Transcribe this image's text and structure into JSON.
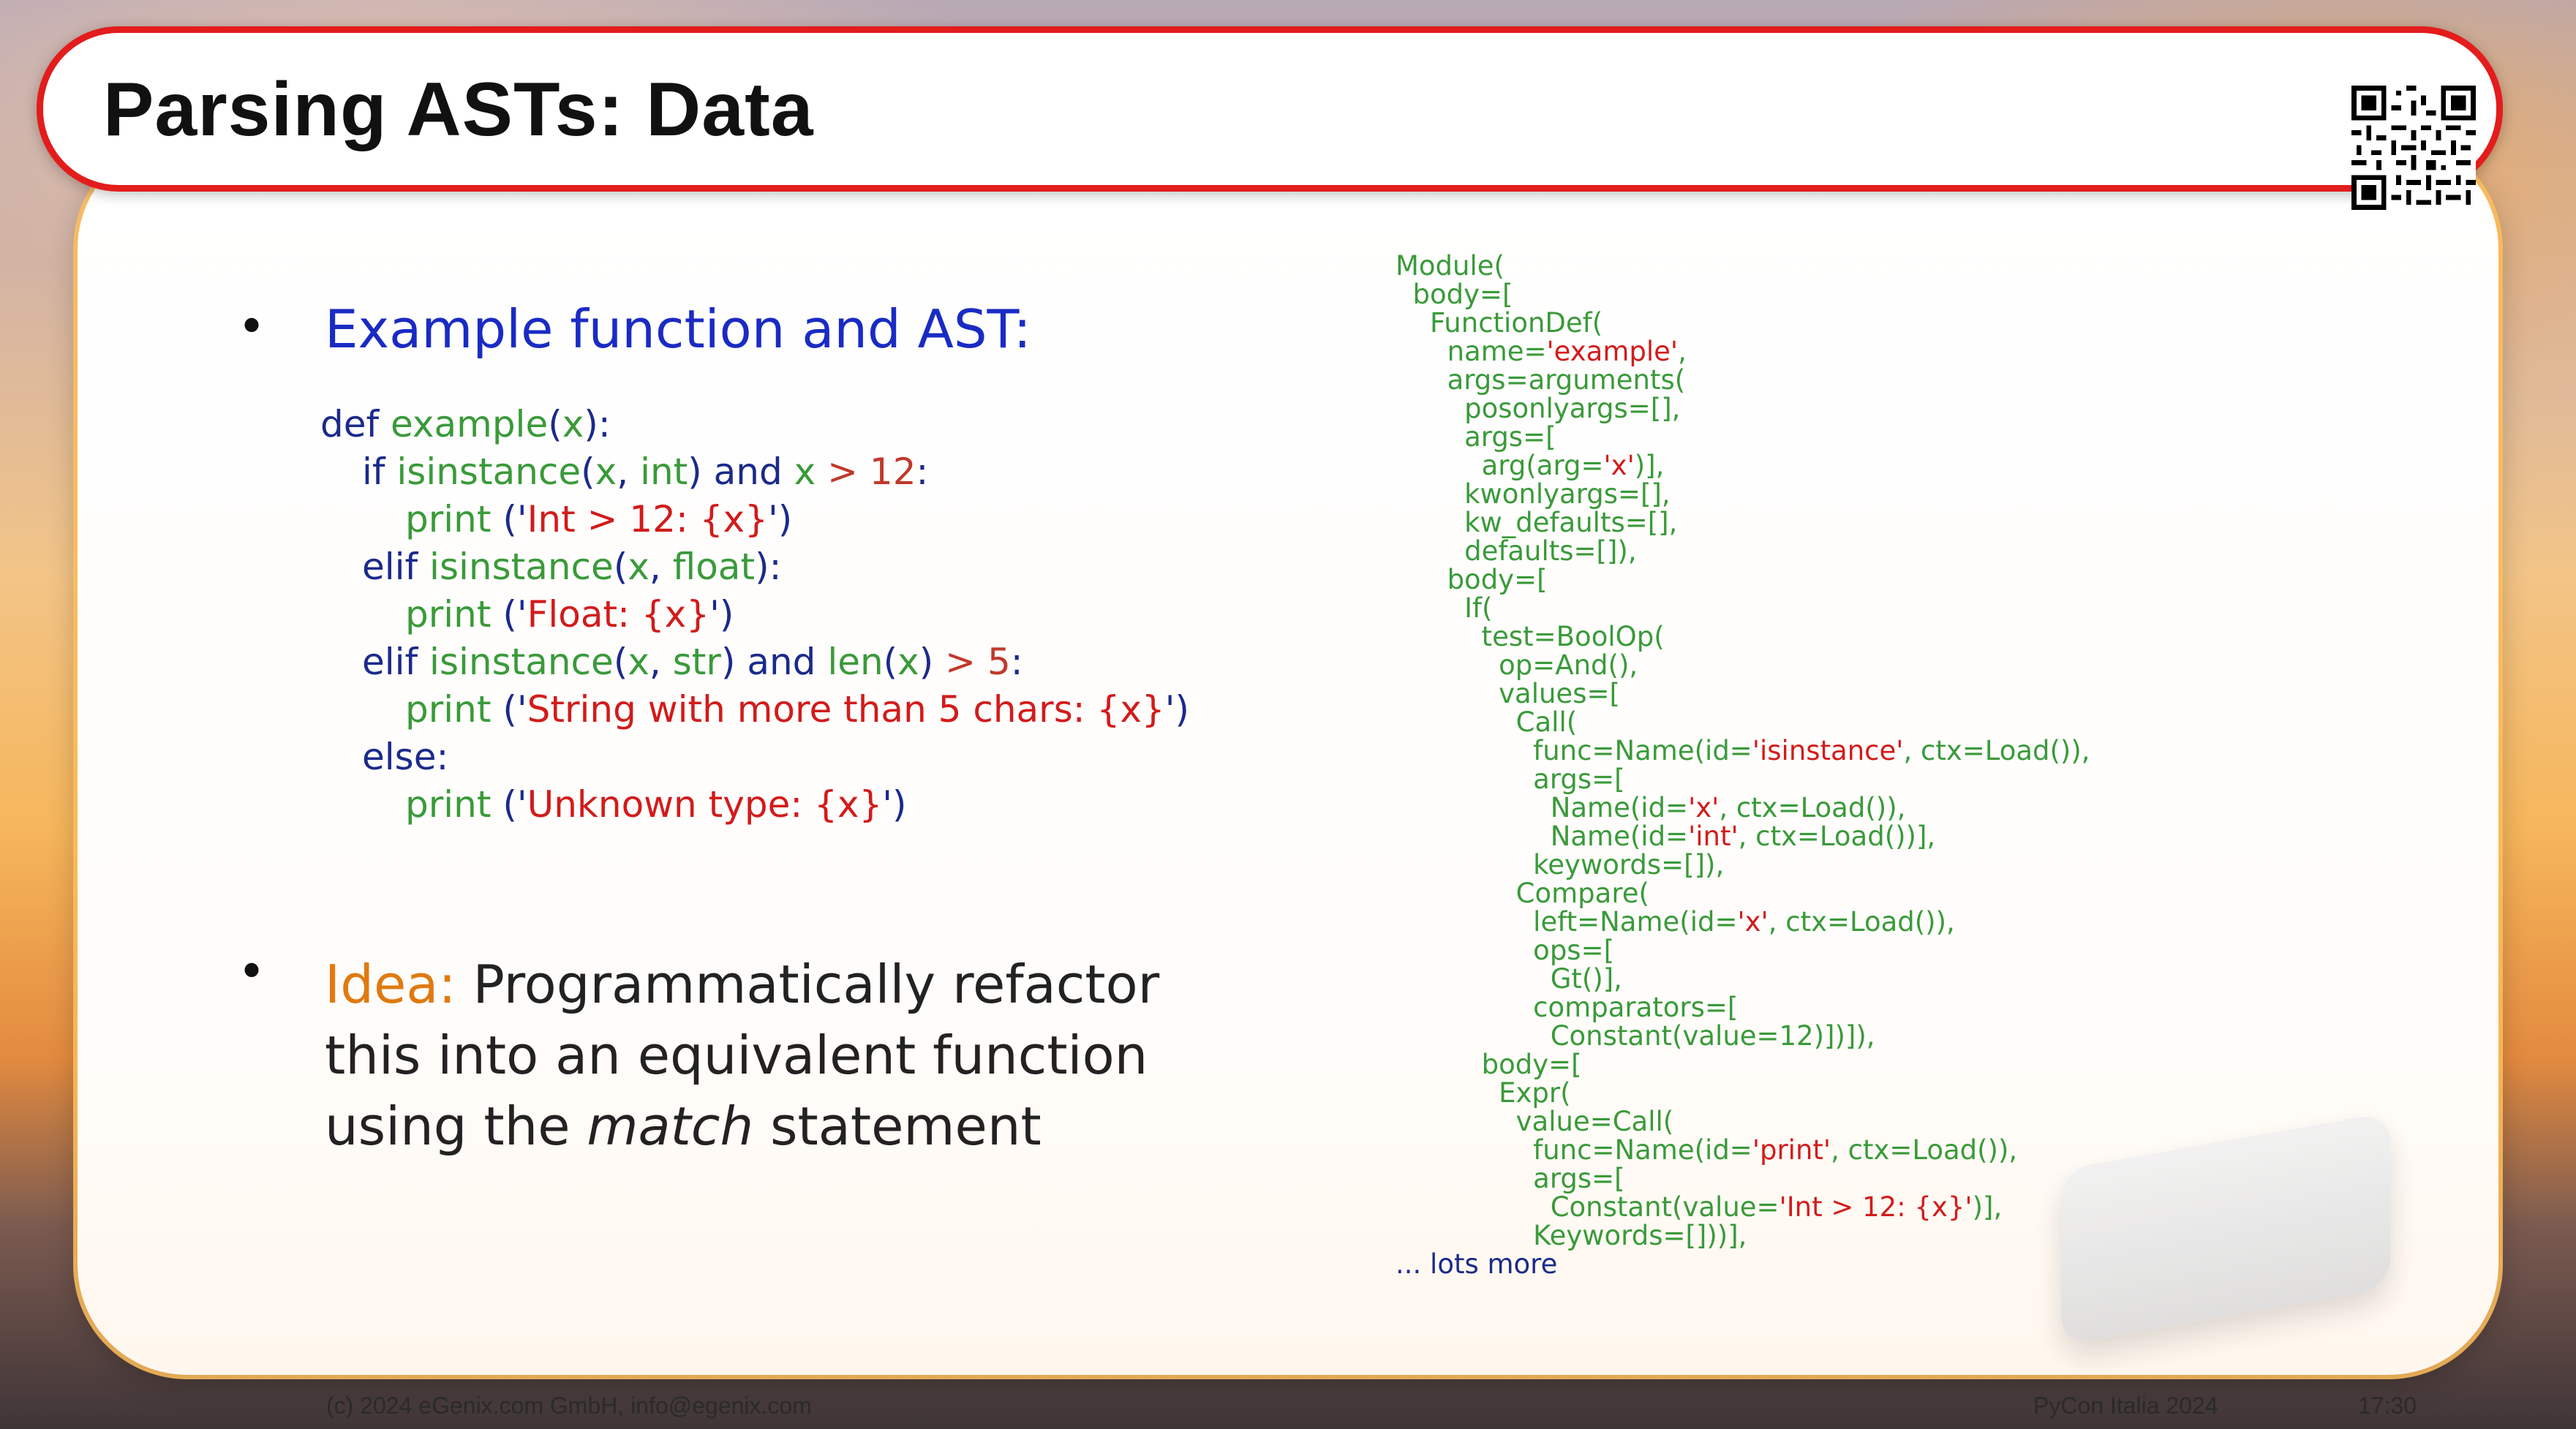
{
  "title": "Parsing ASTs: Data",
  "bullet1": "Example function and AST:",
  "code": {
    "l1": [
      "def ",
      "example",
      "(",
      "x",
      "):"
    ],
    "l2": [
      "if ",
      "isinstance",
      "(",
      "x",
      ", ",
      "int",
      ") ",
      "and ",
      "x",
      " > ",
      "12",
      ":"
    ],
    "l3": [
      "print ",
      "('",
      "Int",
      " > ",
      "12: {x}",
      "')"
    ],
    "l4": [
      "elif ",
      "isinstance",
      "(",
      "x",
      ", ",
      "float",
      "):"
    ],
    "l5": [
      "print ",
      "('",
      "Float: {x}",
      "')"
    ],
    "l6": [
      "elif ",
      "isinstance",
      "(",
      "x",
      ", ",
      "str",
      ") ",
      "and ",
      "len",
      "(",
      "x",
      ") ",
      "> ",
      "5",
      ":"
    ],
    "l7": [
      "print ",
      "('",
      "String with more than 5 chars: {x}",
      "')"
    ],
    "l8": [
      "else:"
    ],
    "l9": [
      "print ",
      "('",
      "Unknown type: {x}",
      "')"
    ]
  },
  "idea": {
    "label": "Idea:",
    "line1": " Programmatically refactor",
    "line2": "this into an equivalent function",
    "line3a": "using the ",
    "line3b": "match",
    "line3c": " statement"
  },
  "ast": {
    "a01": "Module(",
    "a02": "  body=[",
    "a03": "    FunctionDef(",
    "a04a": "      name=",
    "a04b": "'example'",
    "a04c": ",",
    "a05": "      args=arguments(",
    "a06": "        posonlyargs=[],",
    "a07": "        args=[",
    "a08a": "          arg(arg=",
    "a08b": "'x'",
    "a08c": ")],",
    "a09": "        kwonlyargs=[],",
    "a10": "        kw_defaults=[],",
    "a11": "        defaults=[]),",
    "a12": "      body=[",
    "a13": "        If(",
    "a14": "          test=BoolOp(",
    "a15": "            op=And(),",
    "a16": "            values=[",
    "a17": "              Call(",
    "a18a": "                func=Name(id=",
    "a18b": "'isinstance'",
    "a18c": ", ctx=Load()),",
    "a19": "                args=[",
    "a20a": "                  Name(id=",
    "a20b": "'x'",
    "a20c": ", ctx=Load()),",
    "a21a": "                  Name(id=",
    "a21b": "'int'",
    "a21c": ", ctx=Load())],",
    "a22": "                keywords=[]),",
    "a23": "              Compare(",
    "a24a": "                left=Name(id=",
    "a24b": "'x'",
    "a24c": ", ctx=Load()),",
    "a25": "                ops=[",
    "a26": "                  Gt()],",
    "a27": "                comparators=[",
    "a28": "                  Constant(value=12)])]),",
    "a29": "          body=[",
    "a30": "            Expr(",
    "a31": "              value=Call(",
    "a32a": "                func=Name(id=",
    "a32b": "'print'",
    "a32c": ", ctx=Load()),",
    "a33": "                args=[",
    "a34a": "                  Constant(value=",
    "a34b": "'Int > 12: {x}'",
    "a34c": ")],",
    "a35": "                Keywords=[]))],",
    "a36": "... lots more"
  },
  "footer": {
    "left": "(c) 2024 eGenix.com GmbH, info@egenix.com",
    "right": "PyCon Italia 2024",
    "time": "17:30"
  },
  "colors": {
    "title_border": "#e31c1c",
    "bullet_blue": "#1a2bc4",
    "code_green": "#3a9a3a",
    "string_red": "#d21b1b",
    "idea_orange": "#e07a10"
  },
  "icons": [
    "qr-code-icon"
  ]
}
